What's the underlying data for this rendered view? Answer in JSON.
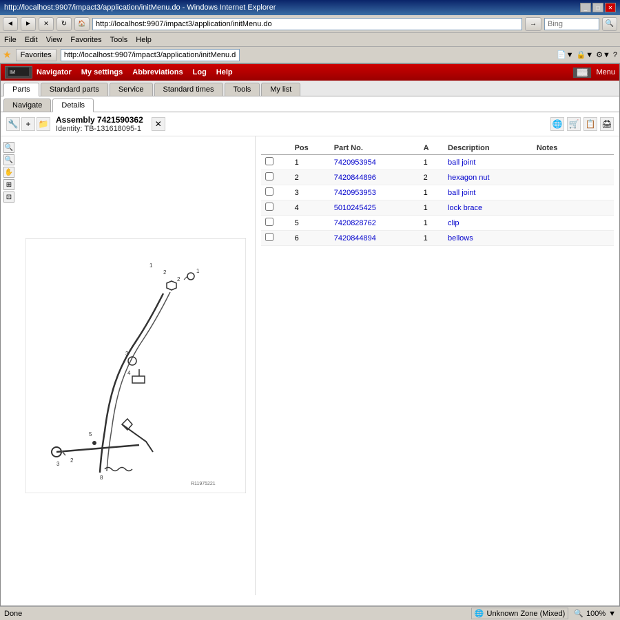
{
  "browser": {
    "title": "http://localhost:9907/impact3/application/initMenu.do - Windows Internet Explorer",
    "address": "http://localhost:9907/impact3/application/initMenu.do",
    "bing_text": "Bing",
    "menu_items": [
      "File",
      "Edit",
      "View",
      "Favorites",
      "Tools",
      "Help"
    ],
    "favorites_label": "Favorites",
    "favorites_url": "http://localhost:9907/impact3/application/initMenu.do",
    "nav_buttons": [
      "◄",
      "►",
      "✕",
      "↻"
    ],
    "title_buttons": [
      "_",
      "□",
      "✕"
    ]
  },
  "app_nav": {
    "logo_text": "Menu",
    "items": [
      "Navigator",
      "My settings",
      "Abbreviations",
      "Log",
      "Help"
    ],
    "menu_label": "Menu"
  },
  "tabs": {
    "main": [
      "Parts",
      "Standard parts",
      "Service",
      "Standard times",
      "Tools",
      "My list"
    ],
    "main_active": "Parts",
    "sub": [
      "Navigate",
      "Details"
    ],
    "sub_active": "Details"
  },
  "assembly": {
    "title": "Assembly 7421590362",
    "identity": "Identity: TB-131618095-1"
  },
  "toolbar": {
    "icons": [
      "globe",
      "cart",
      "copy",
      "print"
    ]
  },
  "parts_table": {
    "headers": [
      "",
      "Pos",
      "Part No.",
      "A",
      "Description",
      "Notes",
      "",
      ""
    ],
    "rows": [
      {
        "pos": "1",
        "part_no": "7420953954",
        "qty": "1",
        "desc": "ball joint",
        "notes": ""
      },
      {
        "pos": "2",
        "part_no": "7420844896",
        "qty": "2",
        "desc": "hexagon nut",
        "notes": ""
      },
      {
        "pos": "3",
        "part_no": "7420953953",
        "qty": "1",
        "desc": "ball joint",
        "notes": ""
      },
      {
        "pos": "4",
        "part_no": "5010245425",
        "qty": "1",
        "desc": "lock brace",
        "notes": ""
      },
      {
        "pos": "5",
        "part_no": "7420828762",
        "qty": "1",
        "desc": "clip",
        "notes": ""
      },
      {
        "pos": "6",
        "part_no": "7420844894",
        "qty": "1",
        "desc": "bellows",
        "notes": ""
      }
    ]
  },
  "status": {
    "left": "Done",
    "zone": "Unknown Zone (Mixed)",
    "zoom": "100%"
  }
}
